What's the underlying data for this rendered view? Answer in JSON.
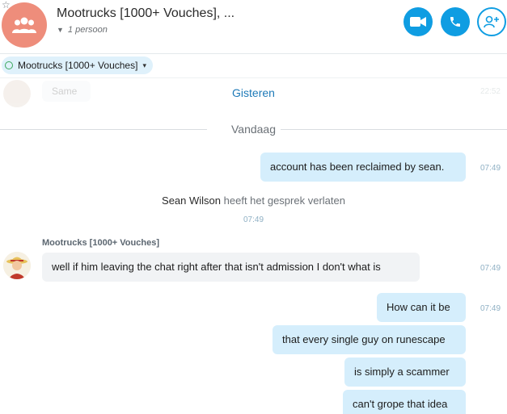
{
  "header": {
    "title": "Mootrucks [1000+ Vouches], ...",
    "participants": "1 persoon",
    "accent_color": "#0f9de2",
    "avatar_color": "#ee8d7b"
  },
  "chip": {
    "label": "Mootrucks [1000+ Vouches]"
  },
  "faded_message": {
    "text": "Same",
    "time": "22:52"
  },
  "day_labels": {
    "yesterday": "Gisteren",
    "today": "Vandaag"
  },
  "messages": {
    "m1": {
      "text": "account has been reclaimed by sean.",
      "time": "07:49"
    },
    "system": {
      "name": "Sean Wilson",
      "action": "heeft het gesprek verlaten",
      "time": "07:49"
    },
    "sender_name": "Mootrucks [1000+ Vouches]",
    "m2": {
      "text": "well if him leaving the chat right after that isn't admission I don't what is",
      "time": "07:49"
    },
    "m3": {
      "text": "How can it be",
      "time": "07:49"
    },
    "m4": {
      "text": "that every single guy on runescape"
    },
    "m5": {
      "text": "is simply a scammer"
    },
    "m6": {
      "text": "can't grope that idea"
    }
  }
}
